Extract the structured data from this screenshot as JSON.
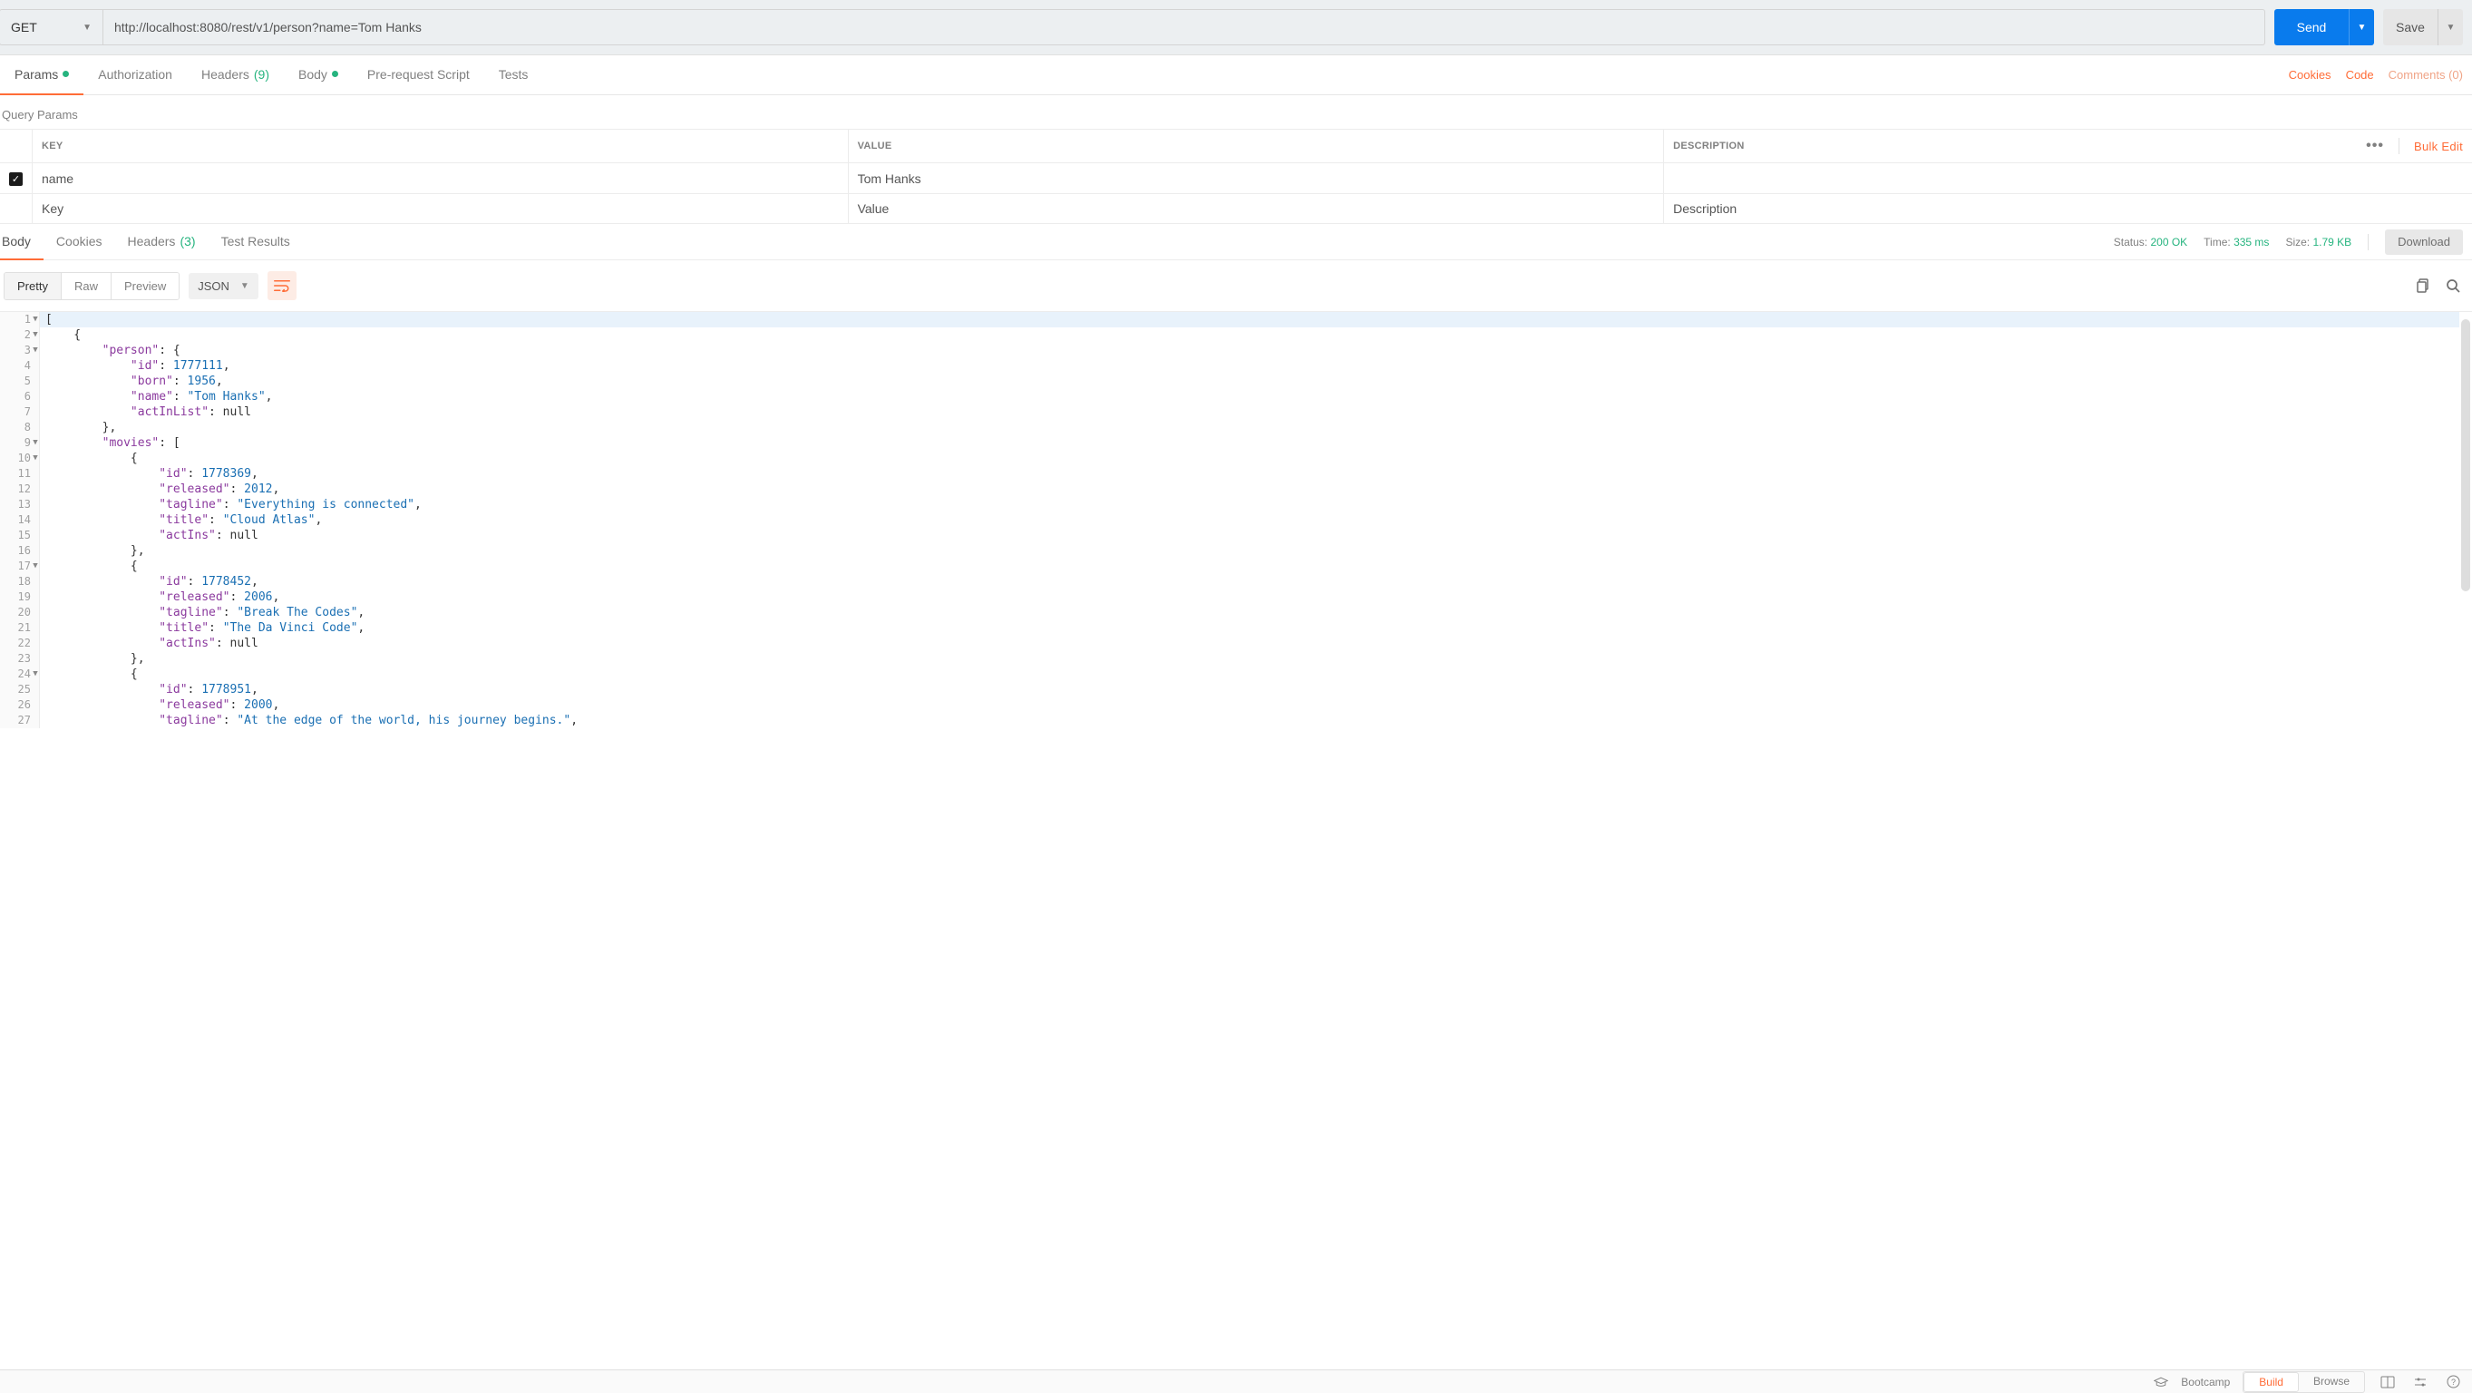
{
  "request": {
    "method": "GET",
    "url": "http://localhost:8080/rest/v1/person?name=Tom Hanks",
    "send_label": "Send",
    "save_label": "Save"
  },
  "req_tabs": {
    "params": "Params",
    "auth": "Authorization",
    "headers": "Headers",
    "headers_count": "(9)",
    "body": "Body",
    "prerequest": "Pre-request Script",
    "tests": "Tests"
  },
  "req_links": {
    "cookies": "Cookies",
    "code": "Code",
    "comments": "Comments (0)"
  },
  "query_params": {
    "title": "Query Params",
    "th_key": "KEY",
    "th_value": "VALUE",
    "th_desc": "DESCRIPTION",
    "more": "•••",
    "bulk": "Bulk Edit",
    "rows": [
      {
        "checked": true,
        "key": "name",
        "value": "Tom Hanks",
        "desc": ""
      }
    ],
    "ph_key": "Key",
    "ph_value": "Value",
    "ph_desc": "Description"
  },
  "resp_tabs": {
    "body": "Body",
    "cookies": "Cookies",
    "headers": "Headers",
    "headers_count": "(3)",
    "tests": "Test Results"
  },
  "resp_meta": {
    "status_label": "Status:",
    "status_value": "200 OK",
    "time_label": "Time:",
    "time_value": "335 ms",
    "size_label": "Size:",
    "size_value": "1.79 KB",
    "download": "Download"
  },
  "view": {
    "pretty": "Pretty",
    "raw": "Raw",
    "preview": "Preview",
    "format": "JSON"
  },
  "footer": {
    "bootcamp": "Bootcamp",
    "build": "Build",
    "browse": "Browse"
  },
  "code": {
    "tokens": [
      [
        {
          "t": "[",
          "c": "pun"
        }
      ],
      [
        {
          "t": "    {",
          "c": "pun"
        }
      ],
      [
        {
          "t": "        ",
          "c": "pun"
        },
        {
          "t": "\"person\"",
          "c": "key"
        },
        {
          "t": ": {",
          "c": "pun"
        }
      ],
      [
        {
          "t": "            ",
          "c": "pun"
        },
        {
          "t": "\"id\"",
          "c": "key"
        },
        {
          "t": ": ",
          "c": "pun"
        },
        {
          "t": "1777111",
          "c": "num"
        },
        {
          "t": ",",
          "c": "pun"
        }
      ],
      [
        {
          "t": "            ",
          "c": "pun"
        },
        {
          "t": "\"born\"",
          "c": "key"
        },
        {
          "t": ": ",
          "c": "pun"
        },
        {
          "t": "1956",
          "c": "num"
        },
        {
          "t": ",",
          "c": "pun"
        }
      ],
      [
        {
          "t": "            ",
          "c": "pun"
        },
        {
          "t": "\"name\"",
          "c": "key"
        },
        {
          "t": ": ",
          "c": "pun"
        },
        {
          "t": "\"Tom Hanks\"",
          "c": "str"
        },
        {
          "t": ",",
          "c": "pun"
        }
      ],
      [
        {
          "t": "            ",
          "c": "pun"
        },
        {
          "t": "\"actInList\"",
          "c": "key"
        },
        {
          "t": ": ",
          "c": "pun"
        },
        {
          "t": "null",
          "c": "kw"
        }
      ],
      [
        {
          "t": "        },",
          "c": "pun"
        }
      ],
      [
        {
          "t": "        ",
          "c": "pun"
        },
        {
          "t": "\"movies\"",
          "c": "key"
        },
        {
          "t": ": [",
          "c": "pun"
        }
      ],
      [
        {
          "t": "            {",
          "c": "pun"
        }
      ],
      [
        {
          "t": "                ",
          "c": "pun"
        },
        {
          "t": "\"id\"",
          "c": "key"
        },
        {
          "t": ": ",
          "c": "pun"
        },
        {
          "t": "1778369",
          "c": "num"
        },
        {
          "t": ",",
          "c": "pun"
        }
      ],
      [
        {
          "t": "                ",
          "c": "pun"
        },
        {
          "t": "\"released\"",
          "c": "key"
        },
        {
          "t": ": ",
          "c": "pun"
        },
        {
          "t": "2012",
          "c": "num"
        },
        {
          "t": ",",
          "c": "pun"
        }
      ],
      [
        {
          "t": "                ",
          "c": "pun"
        },
        {
          "t": "\"tagline\"",
          "c": "key"
        },
        {
          "t": ": ",
          "c": "pun"
        },
        {
          "t": "\"Everything is connected\"",
          "c": "str"
        },
        {
          "t": ",",
          "c": "pun"
        }
      ],
      [
        {
          "t": "                ",
          "c": "pun"
        },
        {
          "t": "\"title\"",
          "c": "key"
        },
        {
          "t": ": ",
          "c": "pun"
        },
        {
          "t": "\"Cloud Atlas\"",
          "c": "str"
        },
        {
          "t": ",",
          "c": "pun"
        }
      ],
      [
        {
          "t": "                ",
          "c": "pun"
        },
        {
          "t": "\"actIns\"",
          "c": "key"
        },
        {
          "t": ": ",
          "c": "pun"
        },
        {
          "t": "null",
          "c": "kw"
        }
      ],
      [
        {
          "t": "            },",
          "c": "pun"
        }
      ],
      [
        {
          "t": "            {",
          "c": "pun"
        }
      ],
      [
        {
          "t": "                ",
          "c": "pun"
        },
        {
          "t": "\"id\"",
          "c": "key"
        },
        {
          "t": ": ",
          "c": "pun"
        },
        {
          "t": "1778452",
          "c": "num"
        },
        {
          "t": ",",
          "c": "pun"
        }
      ],
      [
        {
          "t": "                ",
          "c": "pun"
        },
        {
          "t": "\"released\"",
          "c": "key"
        },
        {
          "t": ": ",
          "c": "pun"
        },
        {
          "t": "2006",
          "c": "num"
        },
        {
          "t": ",",
          "c": "pun"
        }
      ],
      [
        {
          "t": "                ",
          "c": "pun"
        },
        {
          "t": "\"tagline\"",
          "c": "key"
        },
        {
          "t": ": ",
          "c": "pun"
        },
        {
          "t": "\"Break The Codes\"",
          "c": "str"
        },
        {
          "t": ",",
          "c": "pun"
        }
      ],
      [
        {
          "t": "                ",
          "c": "pun"
        },
        {
          "t": "\"title\"",
          "c": "key"
        },
        {
          "t": ": ",
          "c": "pun"
        },
        {
          "t": "\"The Da Vinci Code\"",
          "c": "str"
        },
        {
          "t": ",",
          "c": "pun"
        }
      ],
      [
        {
          "t": "                ",
          "c": "pun"
        },
        {
          "t": "\"actIns\"",
          "c": "key"
        },
        {
          "t": ": ",
          "c": "pun"
        },
        {
          "t": "null",
          "c": "kw"
        }
      ],
      [
        {
          "t": "            },",
          "c": "pun"
        }
      ],
      [
        {
          "t": "            {",
          "c": "pun"
        }
      ],
      [
        {
          "t": "                ",
          "c": "pun"
        },
        {
          "t": "\"id\"",
          "c": "key"
        },
        {
          "t": ": ",
          "c": "pun"
        },
        {
          "t": "1778951",
          "c": "num"
        },
        {
          "t": ",",
          "c": "pun"
        }
      ],
      [
        {
          "t": "                ",
          "c": "pun"
        },
        {
          "t": "\"released\"",
          "c": "key"
        },
        {
          "t": ": ",
          "c": "pun"
        },
        {
          "t": "2000",
          "c": "num"
        },
        {
          "t": ",",
          "c": "pun"
        }
      ],
      [
        {
          "t": "                ",
          "c": "pun"
        },
        {
          "t": "\"tagline\"",
          "c": "key"
        },
        {
          "t": ": ",
          "c": "pun"
        },
        {
          "t": "\"At the edge of the world, his journey begins.\"",
          "c": "str"
        },
        {
          "t": ",",
          "c": "pun"
        }
      ]
    ],
    "folds": [
      1,
      2,
      3,
      9,
      10,
      17,
      24
    ]
  }
}
